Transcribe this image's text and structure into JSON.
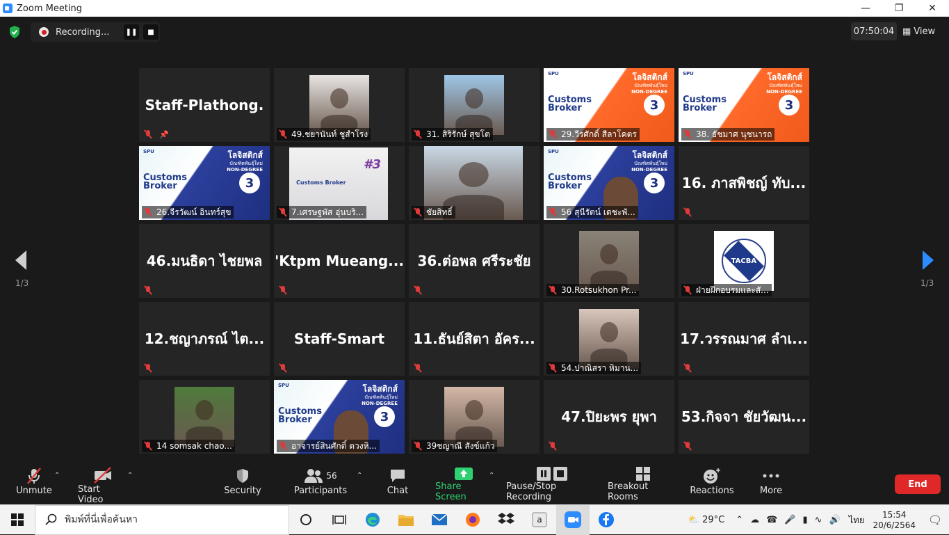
{
  "window": {
    "title": "Zoom Meeting"
  },
  "topbar": {
    "recording_label": "Recording...",
    "elapsed": "07:50:04",
    "view_label": "View"
  },
  "paging": {
    "left": "1/3",
    "right": "1/3"
  },
  "tiles": [
    {
      "kind": "name",
      "big": "Staff-Plathong.",
      "label": "",
      "pinned": true
    },
    {
      "kind": "photo",
      "label": "49.ชยานันท์ ชูสำโรง",
      "photo_color": "#e8e4e2"
    },
    {
      "kind": "photo",
      "label": "31. สิริรักษ์ สุขโต",
      "photo_color": "#9fc6e6"
    },
    {
      "kind": "poster",
      "style": "orange",
      "label": "29.วีรศักดิ์ สีลาโคตร"
    },
    {
      "kind": "poster",
      "style": "orange",
      "label": "38. ธัชมาศ นุชนารถ"
    },
    {
      "kind": "poster",
      "style": "blue",
      "label": "26.จีรวัฒน์ อินทร์สุข"
    },
    {
      "kind": "whiteboard",
      "label": "7.เศรษฐพัส อุ่นบริ..."
    },
    {
      "kind": "photo-wide",
      "label": "ชัยสิทธิ์",
      "photo_color": "#c9d8e6"
    },
    {
      "kind": "poster",
      "style": "blue",
      "label": "56 สุนีรัตน์ เดชะพั...",
      "face": true
    },
    {
      "kind": "name",
      "big": "16. ภาสพิชญ์ ทับ...",
      "label": ""
    },
    {
      "kind": "name",
      "big": "46.มนธิดา  ไชยพล",
      "label": ""
    },
    {
      "kind": "name",
      "big": "'Ktpm  Mueang...",
      "label": ""
    },
    {
      "kind": "name",
      "big": "36.ต่อพล ศรีระชัย",
      "label": ""
    },
    {
      "kind": "photo",
      "label": "30.Rotsukhon Pr...",
      "photo_color": "#8a8378"
    },
    {
      "kind": "tacba",
      "label": "ฝ่ายฝึกอบรมและสั...",
      "logo_text": "TACBA"
    },
    {
      "kind": "name",
      "big": "12.ชญาภรณ์  ไต...",
      "label": ""
    },
    {
      "kind": "name",
      "big": "Staff-Smart",
      "label": ""
    },
    {
      "kind": "name",
      "big": "11.ธันย์สิตา อัคร...",
      "label": ""
    },
    {
      "kind": "photo",
      "label": "54.ปาณิสรา หิมาน...",
      "photo_color": "#d9c6bd"
    },
    {
      "kind": "name",
      "big": "17.วรรณมาศ ลำเ...",
      "label": ""
    },
    {
      "kind": "photo",
      "label": "14 somsak chao...",
      "photo_color": "#4f7a3b"
    },
    {
      "kind": "poster",
      "style": "blue",
      "label": "อาจารย์สินศักดิ์  ดวงหิ...",
      "face": true,
      "active": true
    },
    {
      "kind": "photo",
      "label": "39ชญาณี สังข์แก้ว",
      "photo_color": "#d4b8a8"
    },
    {
      "kind": "name",
      "big": "47.ปิยะพร ยุพา",
      "label": ""
    },
    {
      "kind": "name",
      "big": "53.กิจจา ชัยวัฒน...",
      "label": ""
    }
  ],
  "poster_text": {
    "title": "โลจิสติกส์",
    "sub": "บัณฑิตพันธุ์ใหม่",
    "sub2": "NON-DEGREE",
    "customs": "Customs",
    "broker": "Broker",
    "logos": "SPU",
    "num": "3"
  },
  "whiteboard_text": {
    "text": "Customs Broker",
    "num": "#3"
  },
  "toolbar": {
    "unmute": "Unmute",
    "start_video": "Start Video",
    "security": "Security",
    "participants": "Participants",
    "participants_count": "56",
    "chat": "Chat",
    "share_screen": "Share Screen",
    "pause_recording": "Pause/Stop Recording",
    "breakout": "Breakout Rooms",
    "reactions": "Reactions",
    "more": "More",
    "end": "End"
  },
  "taskbar": {
    "search_placeholder": "พิมพ์ที่นี่เพื่อค้นหา",
    "weather": "29°C",
    "lang": "ไทย",
    "time": "15:54",
    "date": "20/6/2564"
  },
  "colors": {
    "accent_green": "#2fd072",
    "end_red": "#e02828",
    "zoom_blue": "#2d8cff",
    "active_speaker": "#e6e66b"
  }
}
